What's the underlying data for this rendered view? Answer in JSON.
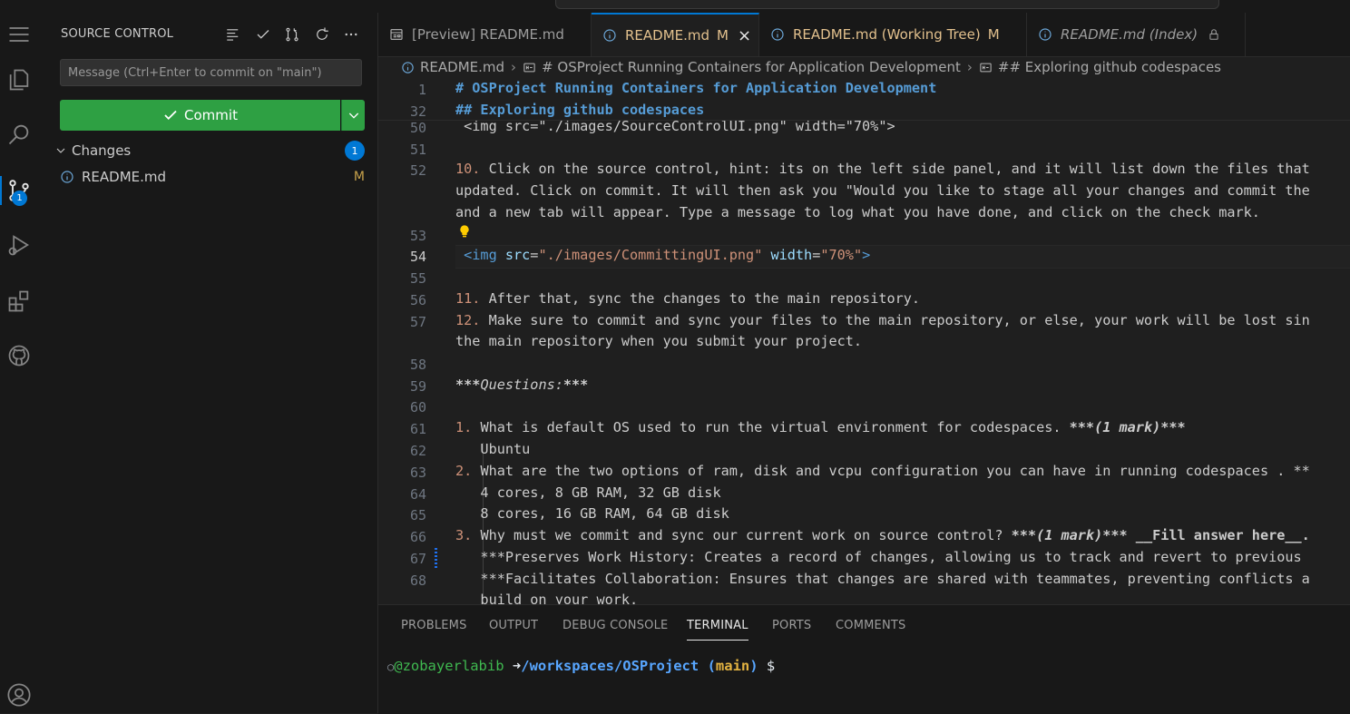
{
  "sidebar": {
    "title": "SOURCE CONTROL",
    "message_placeholder": "Message (Ctrl+Enter to commit on \"main\")",
    "commit_label": "Commit",
    "changes_label": "Changes",
    "changes_count": "1",
    "file": {
      "name": "README.md",
      "status": "M"
    }
  },
  "activity": {
    "source_control_badge": "1"
  },
  "tabs": [
    {
      "label": "[Preview] README.md"
    },
    {
      "label": "README.md",
      "status": "M",
      "close": "×"
    },
    {
      "label": "README.md (Working Tree)",
      "status": "M"
    },
    {
      "label": "README.md (Index)"
    }
  ],
  "breadcrumb": [
    "README.md",
    "# OSProject Running Containers for Application Development",
    "## Exploring github codespaces"
  ],
  "editor": {
    "line_numbers": [
      "1",
      "32",
      "50",
      "51",
      "52",
      "53",
      "54",
      "55",
      "56",
      "57",
      "58",
      "59",
      "60",
      "61",
      "62",
      "63",
      "64",
      "65",
      "66",
      "67",
      "68"
    ],
    "sticky1": "# OSProject Running Containers for Application Development",
    "sticky2": "## Exploring github codespaces",
    "l50": " <img src=\"./images/SourceControlUI.png\" width=\"70%\">",
    "l52a_num": "10.",
    "l52a": " Click on the source control, hint: its on the left side panel, and it will list down the files that",
    "l52b": "updated. Click on commit. It will then ask you \"Would you like to stage all your changes and commit the",
    "l52c": "and a new tab will appear. Type a message to log what you have done, and click on the check mark.",
    "l54_tag_open": " <img",
    "l54_attr1": " src",
    "l54_eq1": "=",
    "l54_val1": "\"./images/CommittingUI.png\"",
    "l54_attr2": " width",
    "l54_eq2": "=",
    "l54_val2": "\"70%\"",
    "l54_tag_close": ">",
    "l56_num": "11.",
    "l56": " After that, sync the changes to the main repository.",
    "l57_num": "12.",
    "l57": " Make sure to commit and sync your files to the main repository, or else, your work will be lost sin",
    "l57b": "the main repository when you submit your project.",
    "l59_a": "***",
    "l59_b": "Questions:",
    "l59_c": "***",
    "l61_num": "1.",
    "l61": " What is default OS used to run the virtual environment for codespaces. ",
    "l61_m": "***(1 mark)***",
    "l62": "   Ubuntu",
    "l63_num": "2.",
    "l63": " What are the two options of ram, disk and vcpu configuration you can have in running codespaces . **",
    "l64": "   4 cores, 8 GB RAM, 32 GB disk",
    "l65": "   8 cores, 16 GB RAM, 64 GB disk",
    "l66_num": "3.",
    "l66": " Why must we commit and sync our current work on source control? ",
    "l66_m": "***(1 mark)***",
    "l66_f": " __Fill answer here__.",
    "l67": "   ***Preserves Work History: Creates a record of changes, allowing us to track and revert to previous",
    "l68": "   ***Facilitates Collaboration: Ensures that changes are shared with teammates, preventing conflicts a",
    "l68b": "   build on your work."
  },
  "panel": {
    "tabs": [
      "PROBLEMS",
      "OUTPUT",
      "DEBUG CONSOLE",
      "TERMINAL",
      "PORTS",
      "COMMENTS"
    ],
    "terminal": {
      "user": "@zobayerlabib",
      "arrow": "➜",
      "path": "/workspaces/OSProject",
      "branch_open": "(",
      "branch": "main",
      "branch_close": ")",
      "prompt": "$"
    }
  }
}
